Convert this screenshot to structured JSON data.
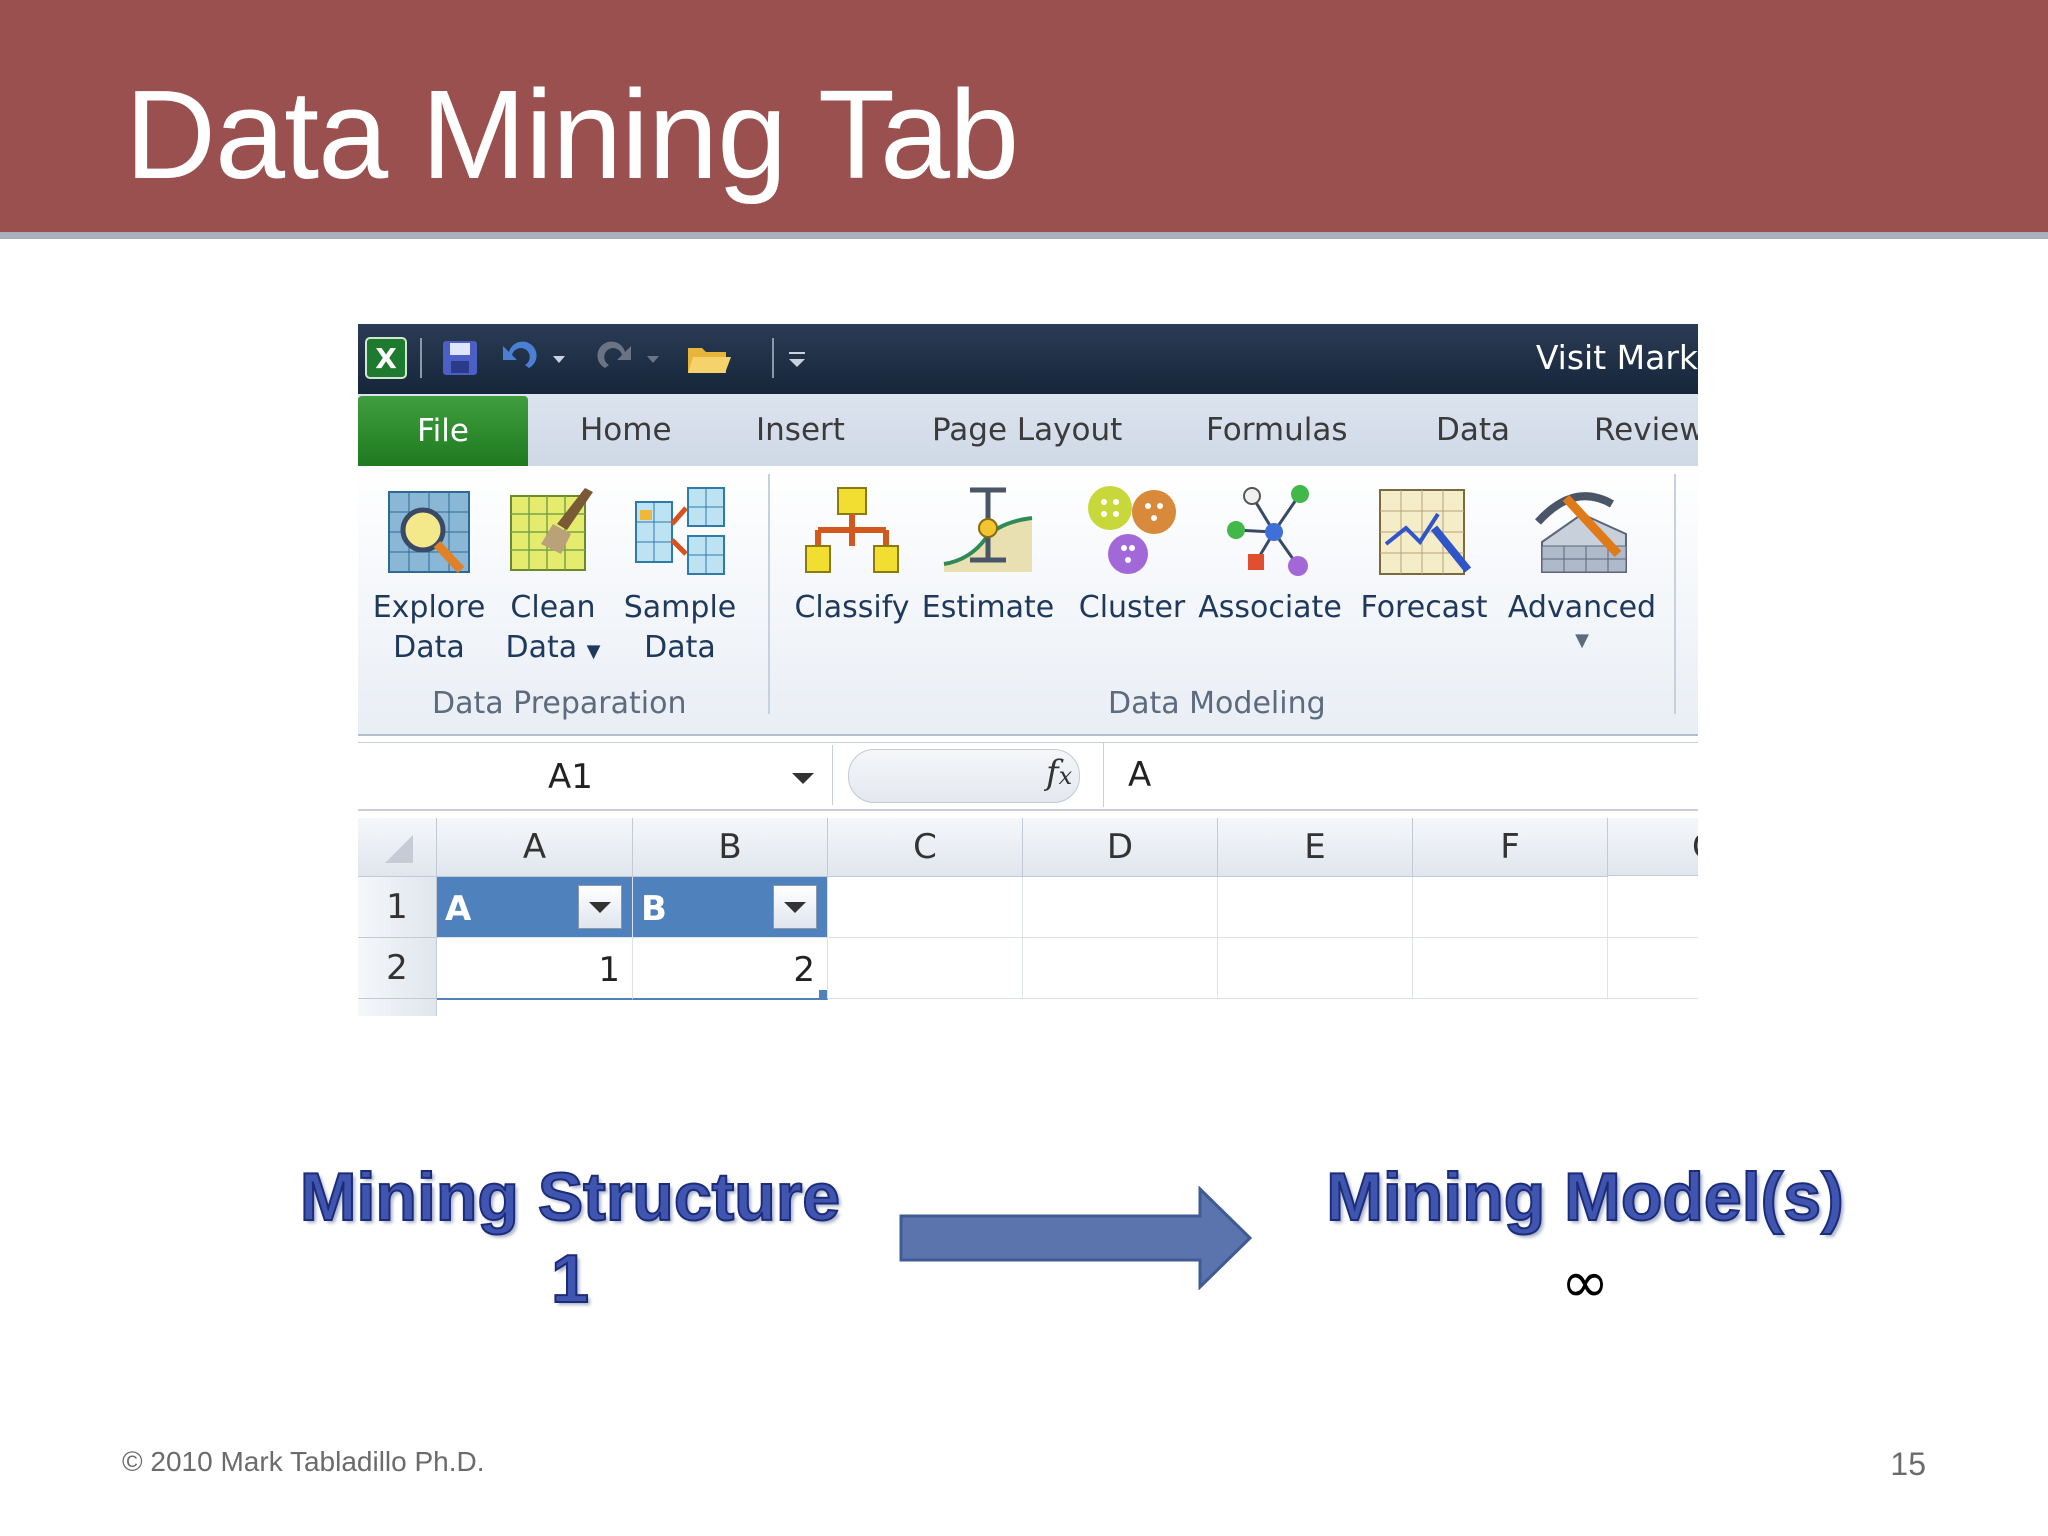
{
  "slide": {
    "title": "Data Mining Tab",
    "footer": "© 2010 Mark Tabladillo Ph.D.",
    "page_number": "15",
    "colors": {
      "header_bg": "#9b5050",
      "accent_text": "#3f55b0",
      "arrow": "#5b74ae"
    }
  },
  "excel": {
    "window_title": "Visit Mark",
    "qat_icons": [
      "excel-logo-icon",
      "save-icon",
      "undo-icon",
      "redo-icon",
      "open-icon",
      "customize-icon"
    ],
    "tabs": [
      "File",
      "Home",
      "Insert",
      "Page Layout",
      "Formulas",
      "Data",
      "Review"
    ],
    "groups": {
      "data_preparation": {
        "label": "Data Preparation",
        "buttons": [
          {
            "line1": "Explore",
            "line2": "Data",
            "icon": "explore-data-icon"
          },
          {
            "line1": "Clean",
            "line2": "Data",
            "icon": "clean-data-icon",
            "has_dropdown": true
          },
          {
            "line1": "Sample",
            "line2": "Data",
            "icon": "sample-data-icon"
          }
        ]
      },
      "data_modeling": {
        "label": "Data Modeling",
        "buttons": [
          {
            "line1": "Classify",
            "icon": "classify-icon"
          },
          {
            "line1": "Estimate",
            "icon": "estimate-icon"
          },
          {
            "line1": "Cluster",
            "icon": "cluster-icon"
          },
          {
            "line1": "Associate",
            "icon": "associate-icon"
          },
          {
            "line1": "Forecast",
            "icon": "forecast-icon"
          },
          {
            "line1": "Advanced",
            "icon": "advanced-icon",
            "has_dropdown": true
          }
        ]
      }
    },
    "formula_bar": {
      "name_box": "A1",
      "fx": "fx",
      "value": "A"
    },
    "grid": {
      "columns": [
        "A",
        "B",
        "C",
        "D",
        "E",
        "F",
        "G"
      ],
      "rows": [
        "1",
        "2"
      ],
      "table": {
        "headers": [
          "A",
          "B"
        ],
        "values": [
          "1",
          "2"
        ]
      }
    }
  },
  "diagram": {
    "structure_label": "Mining Structure",
    "structure_count": "1",
    "model_label": "Mining Model(s)",
    "model_count": "∞"
  }
}
